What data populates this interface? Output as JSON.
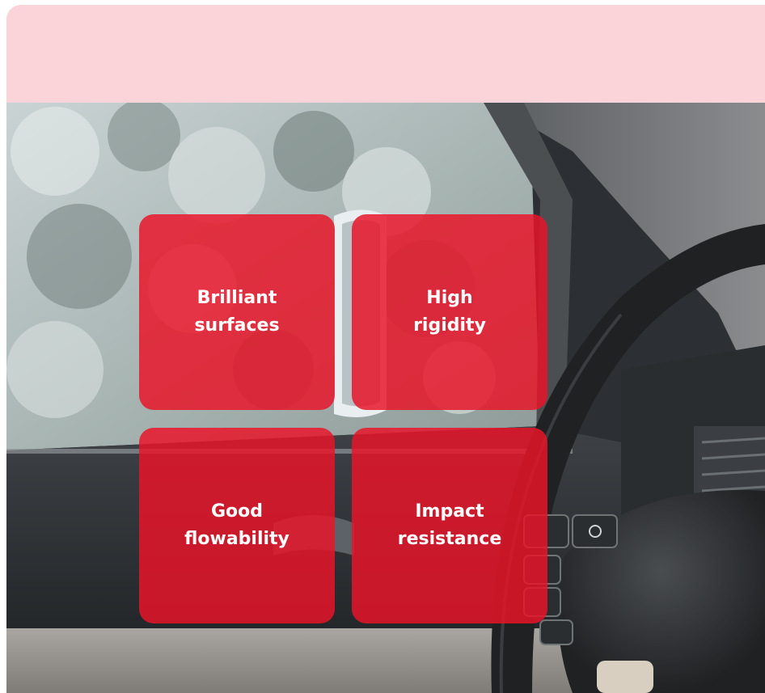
{
  "header": {
    "background_color": "#fad4d8"
  },
  "features": [
    {
      "label": "Brilliant\nsurfaces"
    },
    {
      "label": "High\nrigidity"
    },
    {
      "label": "Good\nflowability"
    },
    {
      "label": "Impact\nresistance"
    }
  ],
  "tile_color": "#e81428",
  "photo": {
    "subject": "car-interior-steering-wheel-image"
  }
}
